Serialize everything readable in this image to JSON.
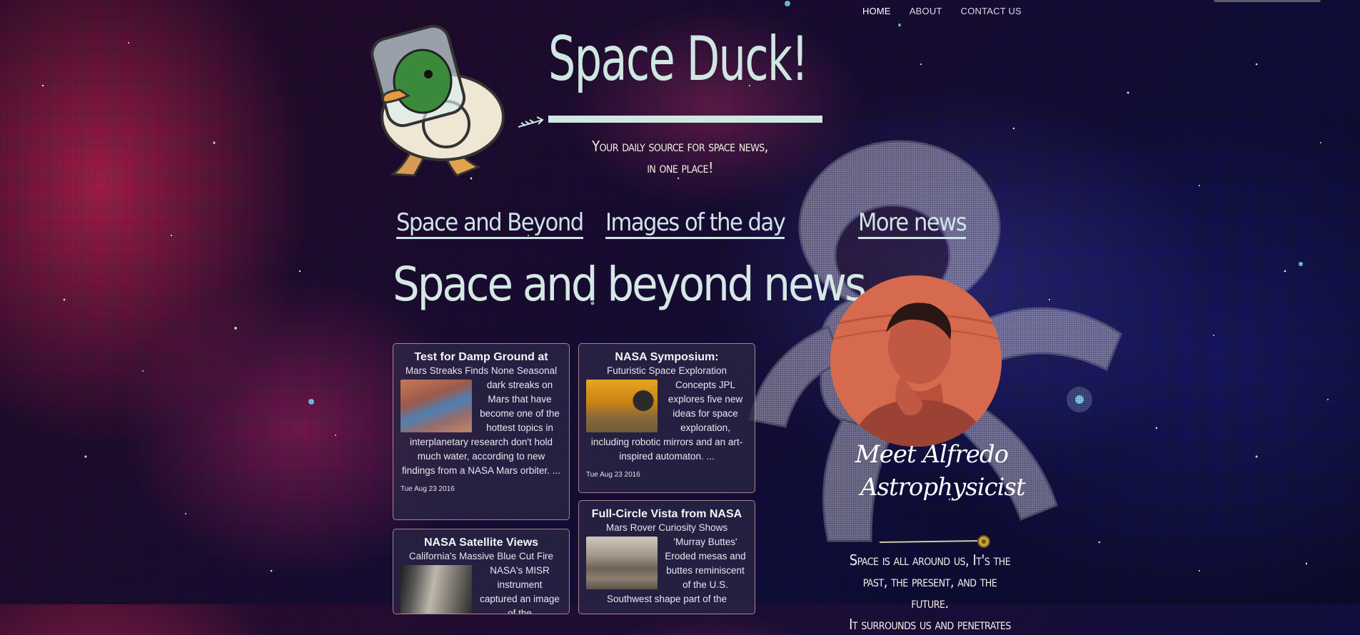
{
  "nav": {
    "items": [
      {
        "label": "HOME"
      },
      {
        "label": "ABOUT"
      },
      {
        "label": "CONTACT US"
      }
    ]
  },
  "header": {
    "brand": "Space Duck!",
    "tagline_line1": "Your daily source for space news,",
    "tagline_line2": "in one place!",
    "logo_icon": "duck-astronaut-icon"
  },
  "sections": {
    "tabs": [
      {
        "label": "Space and Beyond"
      },
      {
        "label": "Images of the day"
      },
      {
        "label": "More news"
      }
    ],
    "title": "Space and beyond news"
  },
  "articles": [
    {
      "title": "Test for Damp Ground at",
      "subtitle": "Mars Streaks Finds None Seasonal",
      "body": "dark streaks on Mars that have become one of the hottest topics in interplanetary research don't hold much water, according to new findings from a NASA Mars orbiter. ...",
      "date": "Tue Aug 23 2016"
    },
    {
      "title": "NASA Symposium:",
      "subtitle": "Futuristic Space Exploration",
      "body": "Concepts JPL explores five new ideas for space exploration, including robotic mirrors and an art-inspired automaton. ...",
      "date": "Tue Aug 23 2016"
    },
    {
      "title": "NASA Satellite Views",
      "subtitle": "California's Massive Blue Cut Fire",
      "body": "NASA's MISR instrument captured an image of the"
    },
    {
      "title": "Full-Circle Vista from NASA",
      "subtitle": "Mars Rover Curiosity Shows",
      "body": "'Murray Buttes' Eroded mesas and buttes reminiscent of the U.S. Southwest shape part of the"
    }
  ],
  "profile": {
    "meet_line1": "Meet Alfredo",
    "meet_line2": "Astrophysicist",
    "quote_line1": "Space is all around us, It's  the",
    "quote_line2": "past, the present, and the future.",
    "quote_line3": "It surrounds us and penetrates"
  }
}
